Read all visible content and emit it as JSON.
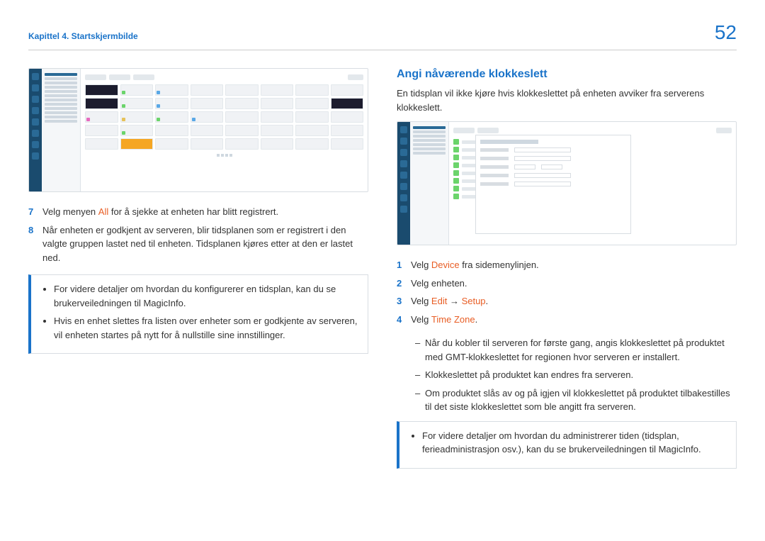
{
  "header": {
    "chapter": "Kapittel 4. Startskjermbilde",
    "page_number": "52"
  },
  "left": {
    "steps": [
      {
        "n": "7",
        "pre": "Velg menyen ",
        "mark": "All",
        "post": " for å sjekke at enheten har blitt registrert."
      },
      {
        "n": "8",
        "pre": "Når enheten er godkjent av serveren, blir tidsplanen som er registrert i den valgte gruppen lastet ned til enheten. Tidsplanen kjøres etter at den er lastet ned.",
        "mark": "",
        "post": ""
      }
    ],
    "notes": [
      "For videre detaljer om hvordan du konfigurerer en tidsplan, kan du se brukerveiledningen til MagicInfo.",
      "Hvis en enhet slettes fra listen over enheter som er godkjente av serveren, vil enheten startes på nytt for å nullstille sine innstillinger."
    ]
  },
  "right": {
    "title": "Angi nåværende klokkeslett",
    "intro": "En tidsplan vil ikke kjøre hvis klokkeslettet på enheten avviker fra serverens klokkeslett.",
    "steps": [
      {
        "n": "1",
        "pre": "Velg ",
        "mark": "Device",
        "post": " fra sidemenylinjen."
      },
      {
        "n": "2",
        "pre": "Velg enheten.",
        "mark": "",
        "post": ""
      },
      {
        "n": "3",
        "pre": "Velg ",
        "mark": "Edit",
        "arrow": " → ",
        "mark2": "Setup",
        "post": "."
      },
      {
        "n": "4",
        "pre": "Velg ",
        "mark": "Time Zone",
        "post": "."
      }
    ],
    "sub": [
      "Når du kobler til serveren for første gang, angis klokkeslettet på produktet med GMT-klokkeslettet for regionen hvor serveren er installert.",
      "Klokkeslettet på produktet kan endres fra serveren.",
      "Om produktet slås av og på igjen vil klokkeslettet på produktet tilbakestilles til det siste klokkeslettet som ble angitt fra serveren."
    ],
    "notes": [
      "For videre detaljer om hvordan du administrerer tiden (tidsplan, ferieadministrasjon osv.), kan du se brukerveiledningen til MagicInfo."
    ]
  }
}
